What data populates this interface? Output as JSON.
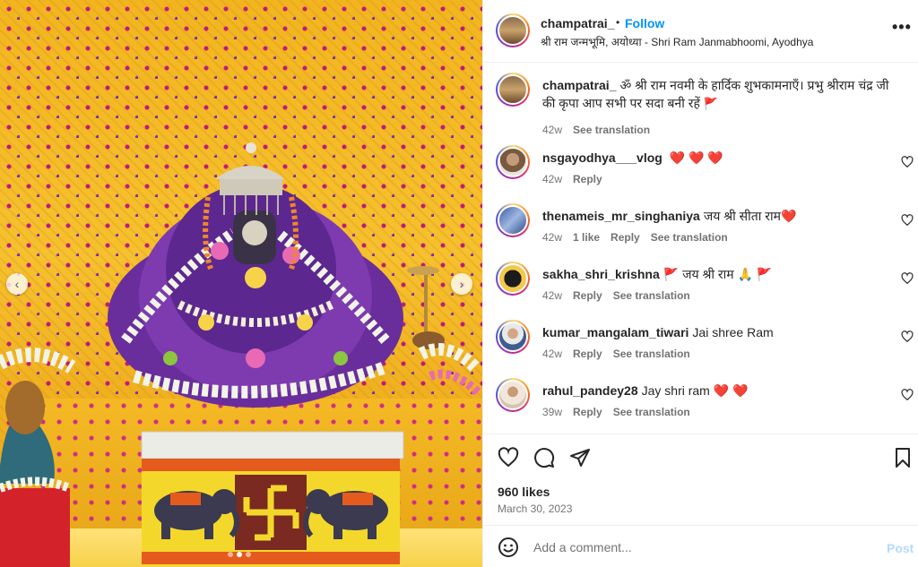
{
  "post": {
    "username": "champatrai_",
    "follow_label": "Follow",
    "separator": "•",
    "location": "श्री राम जन्मभूमि, अयोध्या - Shri Ram Janmabhoomi, Ayodhya",
    "more_label": "•••",
    "caption_user": "champatrai_",
    "caption_text": "ॐ श्री राम नवमी के हार्दिक शुभकामनाएँ। प्रभु श्रीराम चंद्र जी की कृपा आप सभी पर सदा बनी रहें",
    "caption_flag": "🚩",
    "caption_time": "42w",
    "caption_translate": "See translation"
  },
  "comments": [
    {
      "username": "nsgayodhya___vlog",
      "text": "",
      "hearts": "❤️ ❤️ ❤️",
      "time": "42w",
      "likes": "",
      "reply": "Reply",
      "translate": "",
      "avatar_color": "#7a5a3e"
    },
    {
      "username": "thenameis_mr_singhaniya",
      "text": "जय श्री सीता राम",
      "hearts": "❤️",
      "time": "42w",
      "likes": "1 like",
      "reply": "Reply",
      "translate": "See translation",
      "avatar_color": "#3b5da8"
    },
    {
      "username": "sakha_shri_krishna",
      "text": "🚩 जय श्री राम 🙏 🚩",
      "hearts": "",
      "time": "42w",
      "likes": "",
      "reply": "Reply",
      "translate": "See translation",
      "avatar_color": "#1b1b1b"
    },
    {
      "username": "kumar_mangalam_tiwari",
      "text": "Jai shree Ram",
      "hearts": "",
      "time": "42w",
      "likes": "",
      "reply": "Reply",
      "translate": "See translation",
      "avatar_color": "#3e5d8f"
    },
    {
      "username": "rahul_pandey28",
      "text": "Jay shri ram",
      "hearts": "❤️ ❤️",
      "time": "39w",
      "likes": "",
      "reply": "Reply",
      "translate": "See translation",
      "avatar_color": "#c89a76"
    }
  ],
  "actions": {
    "likes_text": "960 likes",
    "date_text": "March 30, 2023",
    "like_icon": "heart-icon",
    "comment_icon": "comment-icon",
    "share_icon": "send-icon",
    "save_icon": "bookmark-icon"
  },
  "add_comment": {
    "placeholder": "Add a comment...",
    "post_label": "Post"
  },
  "media": {
    "left_arrow": "‹",
    "right_arrow": "›",
    "slide_count": 3,
    "active_slide": 2
  },
  "colors": {
    "follow": "#0095f6",
    "post_disabled": "#b3dbff",
    "meta_gray": "#737373",
    "curtain_yellow": "#f2b51f"
  }
}
